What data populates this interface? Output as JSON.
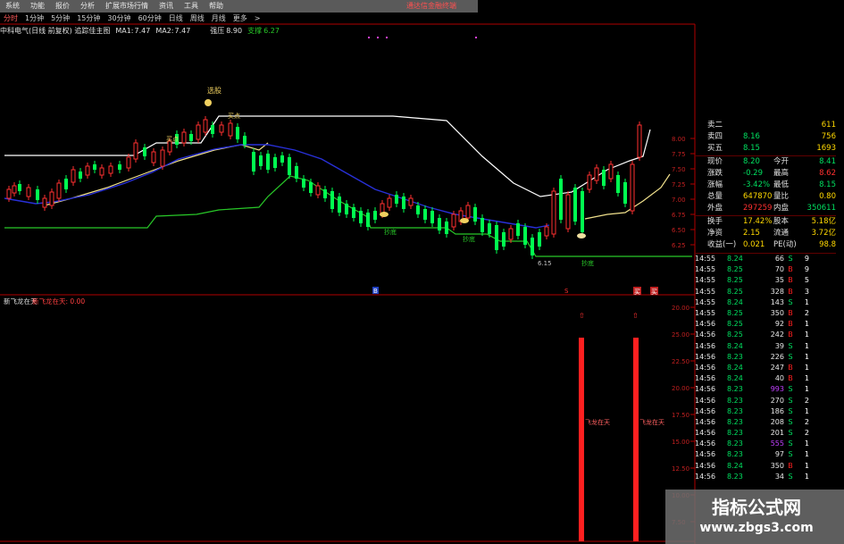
{
  "menubar": {
    "items": [
      "系统",
      "功能",
      "报价",
      "分析",
      "扩展市场行情",
      "资讯",
      "工具",
      "帮助"
    ],
    "notice": "通达信金融终端"
  },
  "periods": {
    "tabs": [
      "分时",
      "1分钟",
      "5分钟",
      "15分钟",
      "30分钟",
      "60分钟",
      "日线",
      "周线",
      "月线",
      "更多"
    ],
    "active": 0,
    "more_arrow": ">"
  },
  "infobar": {
    "stock": "中科电气(日线 前复权) 追踪佳主图",
    "ma1_label": "MA1:",
    "ma1_value": "7.47",
    "ma2_label": "MA2:",
    "ma2_value": "7.47",
    "pressure_label": "强压",
    "pressure_value": "8.90",
    "support_label": "支撑",
    "support_value": "6.27"
  },
  "upper_scale": [
    "8.00",
    "7.75",
    "7.50",
    "7.25",
    "7.00",
    "6.75",
    "6.50",
    "6.25"
  ],
  "lower_scale": [
    "20.00",
    "25.00",
    "22.50",
    "20.00",
    "17.50",
    "15.00",
    "12.50",
    "10.00",
    "7.50"
  ],
  "annotations": {
    "top_signal": "选股",
    "buy1": "买点",
    "buy2": "买点",
    "buy3": "买点",
    "low_price": "6.15",
    "bottom_left": "抄底",
    "bottom_mid": "抄底",
    "bottom_right": "抄底"
  },
  "mid_markers": {
    "m1": "B",
    "m2": "S",
    "m3": "买",
    "m4": "买"
  },
  "subchart": {
    "name": "新飞龙在天",
    "value_label": "新飞龙在天: 0.00",
    "bar_label": "飞龙在天"
  },
  "quote": {
    "rows": [
      {
        "label": "卖二",
        "value": "",
        "label2": "",
        "value2": "611"
      },
      {
        "label": "卖四",
        "value": "8.16",
        "label2": "",
        "value2": "756"
      },
      {
        "label": "买五",
        "value": "8.15",
        "label2": "",
        "value2": "1693"
      },
      {
        "label": "现价",
        "value": "8.20",
        "label2": "今开",
        "value2": "8.41"
      },
      {
        "label": "涨跌",
        "value": "-0.29",
        "label2": "最高",
        "value2": "8.62"
      },
      {
        "label": "涨幅",
        "value": "-3.42%",
        "label2": "最低",
        "value2": "8.15"
      },
      {
        "label": "总量",
        "value": "647870",
        "label2": "量比",
        "value2": "0.80"
      },
      {
        "label": "外盘",
        "value": "297259",
        "label2": "内盘",
        "value2": "350611"
      },
      {
        "label": "换手",
        "value": "17.42%",
        "label2": "股本",
        "value2": "5.18亿"
      },
      {
        "label": "净资",
        "value": "2.15",
        "label2": "流通",
        "value2": "3.72亿"
      },
      {
        "label": "收益(一)",
        "value": "0.021",
        "label2": "PE(动)",
        "value2": "98.8"
      }
    ]
  },
  "ticks": [
    {
      "t": "14:55",
      "p": "8.24",
      "v": "66",
      "s": "S",
      "n": "9"
    },
    {
      "t": "14:55",
      "p": "8.25",
      "v": "70",
      "s": "B",
      "n": "9"
    },
    {
      "t": "14:55",
      "p": "8.25",
      "v": "35",
      "s": "B",
      "n": "5"
    },
    {
      "t": "14:55",
      "p": "8.25",
      "v": "328",
      "s": "B",
      "n": "3"
    },
    {
      "t": "14:55",
      "p": "8.24",
      "v": "143",
      "s": "S",
      "n": "1"
    },
    {
      "t": "14:55",
      "p": "8.25",
      "v": "350",
      "s": "B",
      "n": "2"
    },
    {
      "t": "14:56",
      "p": "8.25",
      "v": "92",
      "s": "B",
      "n": "1"
    },
    {
      "t": "14:56",
      "p": "8.25",
      "v": "242",
      "s": "B",
      "n": "1"
    },
    {
      "t": "14:56",
      "p": "8.24",
      "v": "39",
      "s": "S",
      "n": "1"
    },
    {
      "t": "14:56",
      "p": "8.23",
      "v": "226",
      "s": "S",
      "n": "1"
    },
    {
      "t": "14:56",
      "p": "8.24",
      "v": "247",
      "s": "B",
      "n": "1"
    },
    {
      "t": "14:56",
      "p": "8.24",
      "v": "40",
      "s": "B",
      "n": "1"
    },
    {
      "t": "14:56",
      "p": "8.23",
      "v": "993",
      "s": "S",
      "n": "1"
    },
    {
      "t": "14:56",
      "p": "8.23",
      "v": "270",
      "s": "S",
      "n": "2"
    },
    {
      "t": "14:56",
      "p": "8.23",
      "v": "186",
      "s": "S",
      "n": "1"
    },
    {
      "t": "14:56",
      "p": "8.23",
      "v": "208",
      "s": "S",
      "n": "2"
    },
    {
      "t": "14:56",
      "p": "8.23",
      "v": "201",
      "s": "S",
      "n": "2"
    },
    {
      "t": "14:56",
      "p": "8.23",
      "v": "555",
      "s": "S",
      "n": "1"
    },
    {
      "t": "14:56",
      "p": "8.23",
      "v": "97",
      "s": "S",
      "n": "1"
    },
    {
      "t": "14:56",
      "p": "8.24",
      "v": "350",
      "s": "B",
      "n": "1"
    },
    {
      "t": "14:56",
      "p": "8.23",
      "v": "34",
      "s": "S",
      "n": "1"
    }
  ],
  "colors": {
    "up": "#ff3030",
    "down": "#00ff50",
    "ma_yellow": "#f0e08c",
    "ma_blue": "#2830d8",
    "resistance": "#ffffff",
    "support": "#28c828",
    "buy": "#ff2020",
    "sell": "#00e060"
  },
  "watermark": {
    "title": "指标公式网",
    "url": "www.zbgs3.com"
  }
}
